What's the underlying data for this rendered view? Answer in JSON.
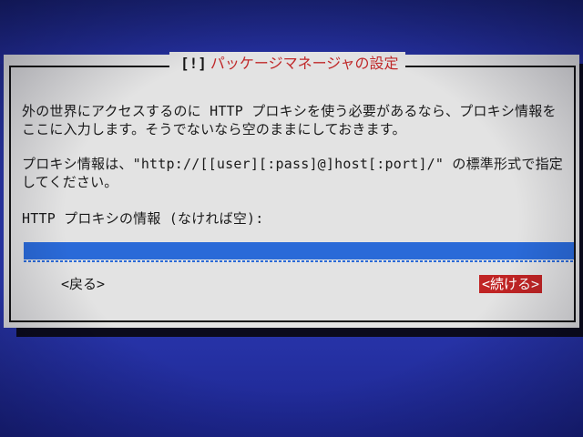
{
  "dialog": {
    "title": "パッケージマネージャの設定",
    "title_left_bracket": "[!]",
    "title_right_bracket": "",
    "paragraph1": "外の世界にアクセスするのに HTTP プロキシを使う必要があるなら、プロキシ情報をここに入力します。そうでないなら空のままにしておきます。",
    "paragraph2": "プロキシ情報は、\"http://[[user][:pass]@]host[:port]/\" の標準形式で指定してください。",
    "field_label": "HTTP プロキシの情報 (なければ空):",
    "field_value": "",
    "back_button": "<戻る>",
    "continue_button": "<続ける>"
  },
  "colors": {
    "background": "#2a36a6",
    "dialog": "#e3e3e3",
    "title_text": "#c0292a",
    "input_fill": "#2a6ad8",
    "selected_button": "#c02424"
  }
}
